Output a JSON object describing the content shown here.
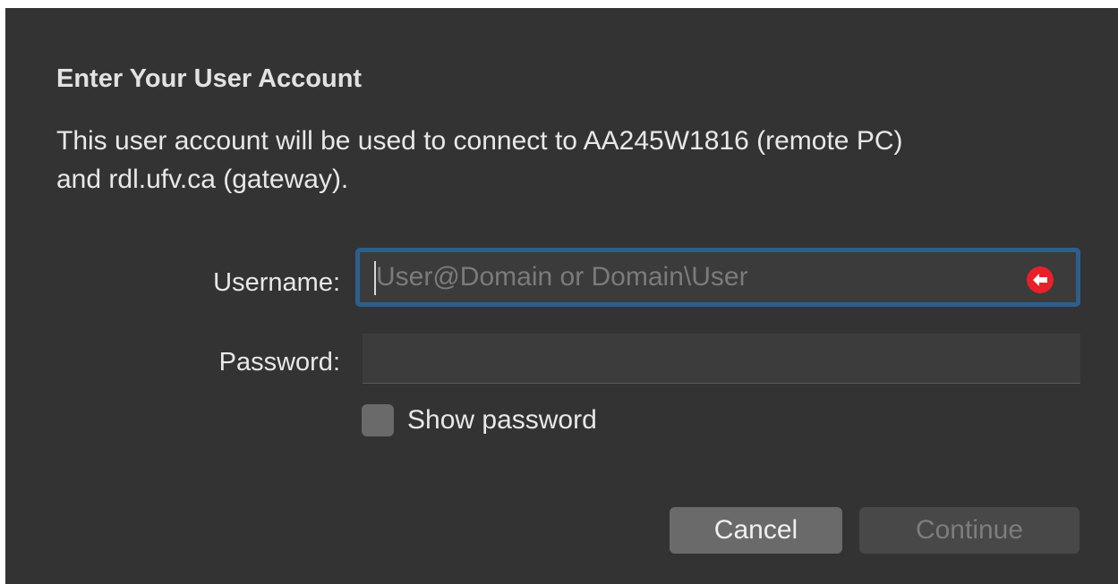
{
  "dialog": {
    "title": "Enter Your User Account",
    "description": "This user account will be used to connect to AA245W1816 (remote PC) and rdl.ufv.ca (gateway).",
    "username": {
      "label": "Username:",
      "value": "",
      "placeholder": "User@Domain or Domain\\User",
      "alert_icon": "red-left-arrow-icon"
    },
    "password": {
      "label": "Password:",
      "value": ""
    },
    "show_password": {
      "label": "Show password",
      "checked": false
    },
    "buttons": {
      "cancel": "Cancel",
      "continue": "Continue"
    }
  },
  "colors": {
    "background": "#333333",
    "focus_ring": "#2d5f8c",
    "alert_red": "#e8202a",
    "cancel_button": "#6a6a6a",
    "continue_button_disabled": "#484848"
  }
}
